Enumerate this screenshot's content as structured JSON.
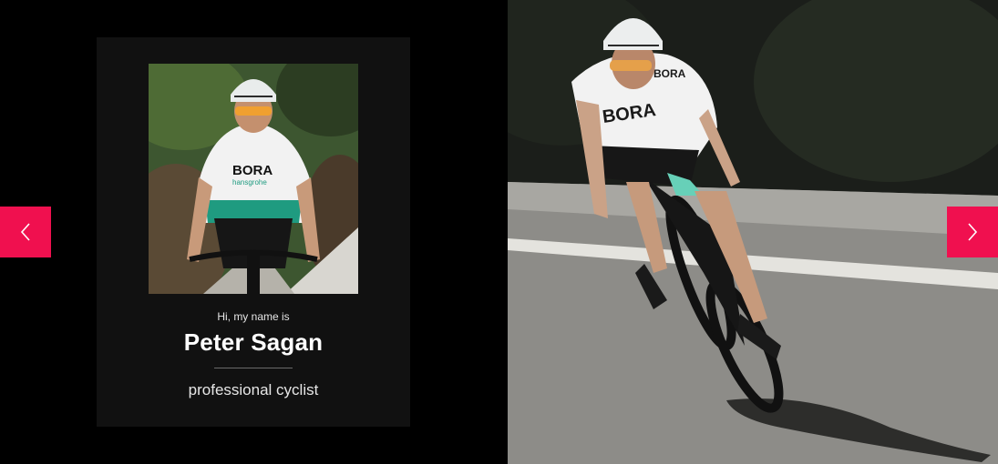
{
  "profile": {
    "intro": "Hi, my name is",
    "name": "Peter Sagan",
    "role": "professional cyclist",
    "portrait_icon": "cyclist-portrait-photo"
  },
  "hero": {
    "image_icon": "cyclist-descending-road-photo"
  },
  "navigation": {
    "prev_icon": "chevron-left-icon",
    "next_icon": "chevron-right-icon"
  },
  "colors": {
    "background": "#000000",
    "card": "#111111",
    "accent": "#f0104f",
    "text": "#ffffff",
    "muted_text": "#e6e6e6"
  }
}
